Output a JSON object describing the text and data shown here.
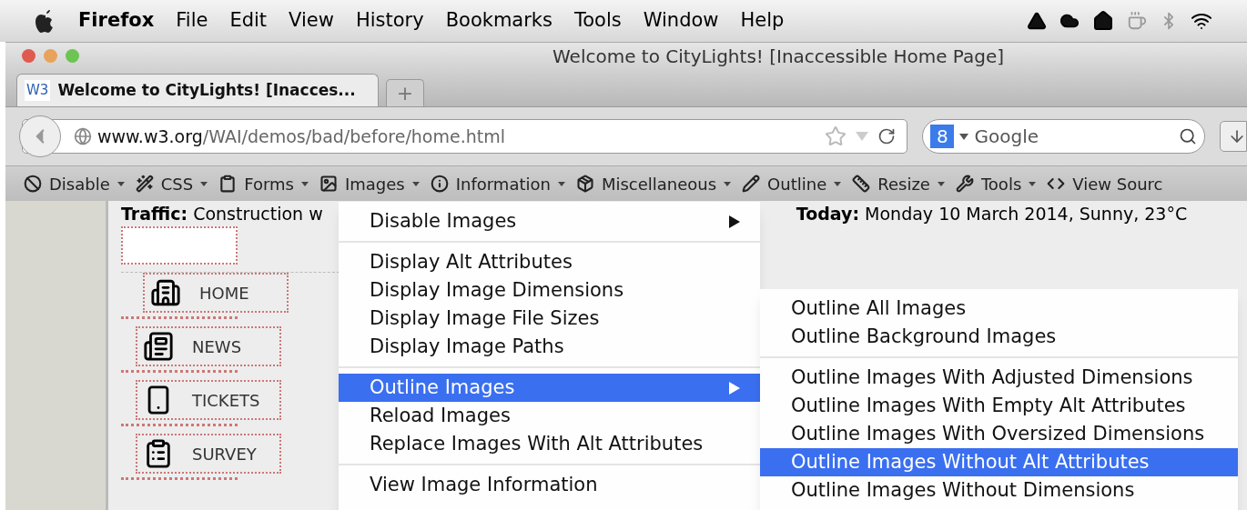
{
  "menubar": {
    "app": "Firefox",
    "items": [
      "File",
      "Edit",
      "View",
      "History",
      "Bookmarks",
      "Tools",
      "Window",
      "Help"
    ]
  },
  "window": {
    "title": "Welcome to CityLights! [Inaccessible Home Page]"
  },
  "tabs": [
    {
      "favicon": "W3",
      "label": "Welcome to CityLights! [Inacces...",
      "selected": true
    },
    {
      "label": "+",
      "selected": false
    }
  ],
  "navbar": {
    "url_domain": "www.w3.org",
    "url_path": "/WAI/demos/bad/before/home.html",
    "search_engine": "8",
    "search_placeholder": "Google"
  },
  "toolbar": [
    {
      "label": "Disable"
    },
    {
      "label": "CSS"
    },
    {
      "label": "Forms"
    },
    {
      "label": "Images"
    },
    {
      "label": "Information"
    },
    {
      "label": "Miscellaneous"
    },
    {
      "label": "Outline"
    },
    {
      "label": "Resize"
    },
    {
      "label": "Tools"
    },
    {
      "label": "View Sourc"
    }
  ],
  "page": {
    "traffic_label": "Traffic:",
    "traffic_text": "Construction w",
    "today_label": "Today:",
    "today_text": "Monday 10 March 2014, Sunny, 23°C",
    "nav": [
      {
        "label": "HOME"
      },
      {
        "label": "NEWS"
      },
      {
        "label": "TICKETS"
      },
      {
        "label": "SURVEY"
      }
    ]
  },
  "images_menu": [
    {
      "kind": "item",
      "label": "Disable Images",
      "submenu": true,
      "selected": false
    },
    {
      "kind": "separator"
    },
    {
      "kind": "item",
      "label": "Display Alt Attributes",
      "submenu": false,
      "selected": false
    },
    {
      "kind": "item",
      "label": "Display Image Dimensions",
      "submenu": false,
      "selected": false
    },
    {
      "kind": "item",
      "label": "Display Image File Sizes",
      "submenu": false,
      "selected": false
    },
    {
      "kind": "item",
      "label": "Display Image Paths",
      "submenu": false,
      "selected": false
    },
    {
      "kind": "separator"
    },
    {
      "kind": "item",
      "label": "Outline Images",
      "submenu": true,
      "selected": true
    },
    {
      "kind": "item",
      "label": "Reload Images",
      "submenu": false,
      "selected": false
    },
    {
      "kind": "item",
      "label": "Replace Images With Alt Attributes",
      "submenu": false,
      "selected": false
    },
    {
      "kind": "separator"
    },
    {
      "kind": "item",
      "label": "View Image Information",
      "submenu": false,
      "selected": false
    }
  ],
  "outline_submenu": [
    {
      "kind": "item",
      "label": "Outline All Images",
      "selected": false
    },
    {
      "kind": "item",
      "label": "Outline Background Images",
      "selected": false
    },
    {
      "kind": "separator"
    },
    {
      "kind": "item",
      "label": "Outline Images With Adjusted Dimensions",
      "selected": false
    },
    {
      "kind": "item",
      "label": "Outline Images With Empty Alt Attributes",
      "selected": false
    },
    {
      "kind": "item",
      "label": "Outline Images With Oversized Dimensions",
      "selected": false
    },
    {
      "kind": "item",
      "label": "Outline Images Without Alt Attributes",
      "selected": true
    },
    {
      "kind": "item",
      "label": "Outline Images Without Dimensions",
      "selected": false
    }
  ]
}
